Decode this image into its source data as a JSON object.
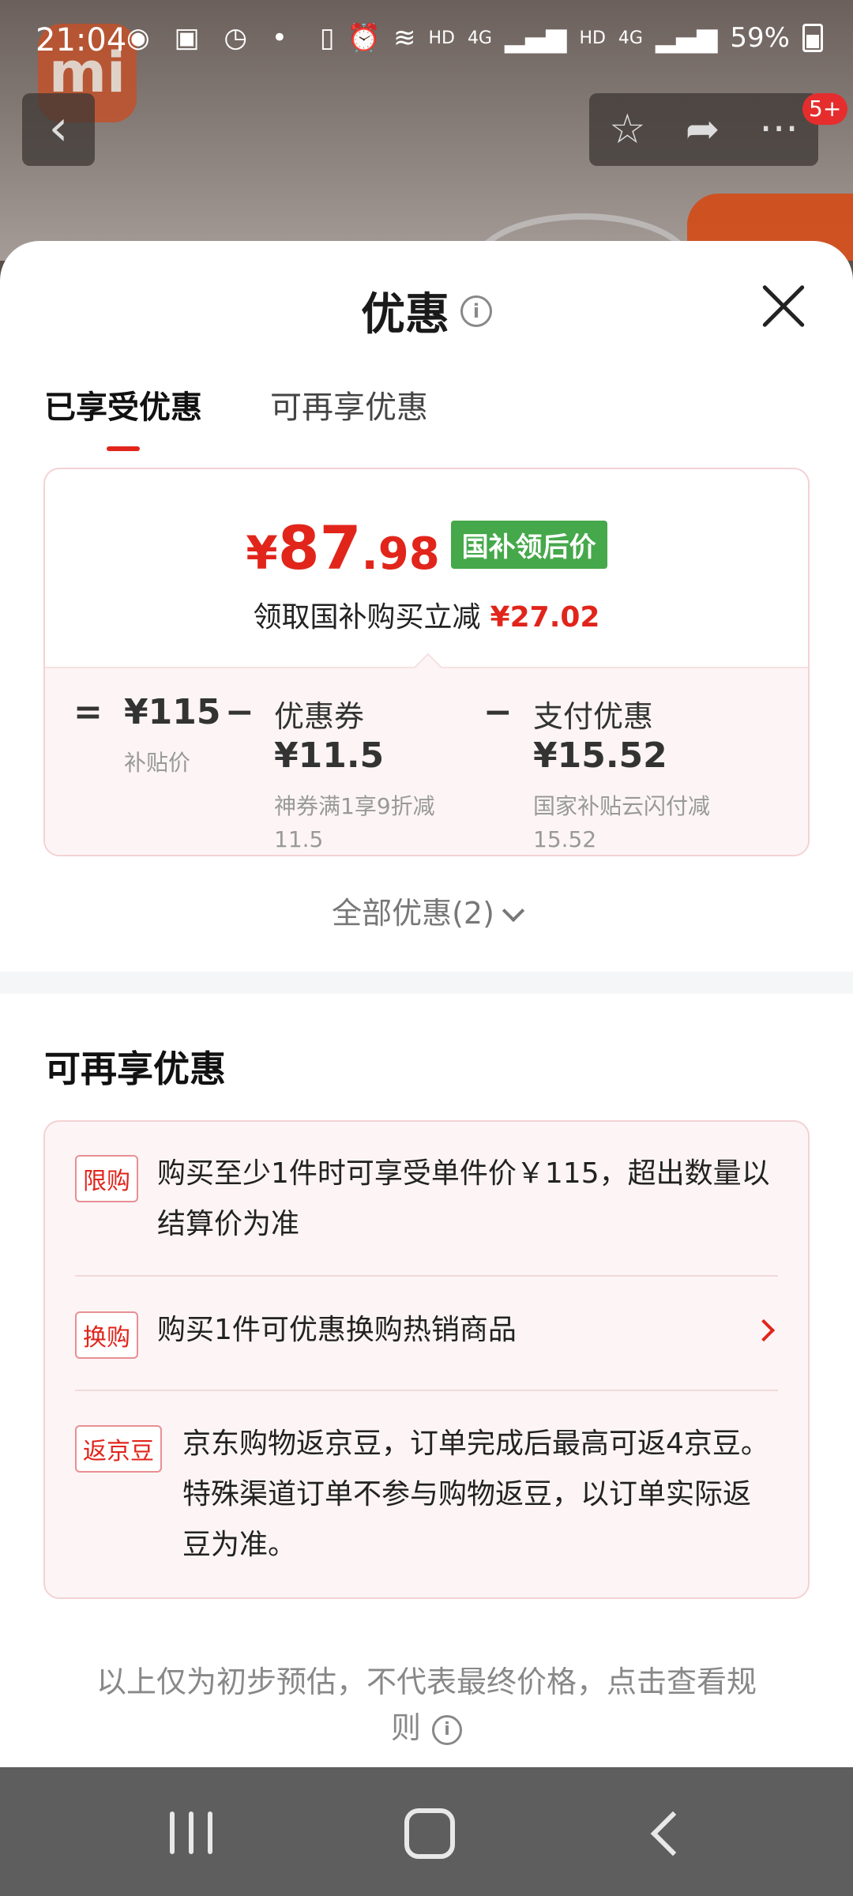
{
  "status_bar": {
    "time": "21:04",
    "network_labels": [
      "HD",
      "4G",
      "HD",
      "4G"
    ],
    "battery": "59%"
  },
  "product_page": {
    "cart_badge": "5+"
  },
  "sheet": {
    "title": "优惠",
    "tabs": [
      {
        "label": "已享受优惠",
        "active": true
      },
      {
        "label": "可再享优惠",
        "active": false
      }
    ],
    "price_card": {
      "currency": "¥",
      "price_integer": "87",
      "price_decimal": ".98",
      "price_tag": "国补领后价",
      "subtitle": "领取国补购买立减",
      "saving": "¥27.02",
      "formula": {
        "equals": "=",
        "term1": {
          "value": "¥115",
          "desc": "补贴价"
        },
        "minus1": "−",
        "term2": {
          "label": "优惠券",
          "value": "¥11.5",
          "desc": "神券满1享9折减11.5"
        },
        "minus2": "−",
        "term3": {
          "label": "支付优惠",
          "value": "¥15.52",
          "desc": "国家补贴云闪付减15.52"
        }
      }
    },
    "all_promos": "全部优惠(2)",
    "more_section": {
      "title": "可再享优惠",
      "items": [
        {
          "tag": "限购",
          "text": "购买至少1件时可享受单件价￥115，超出数量以结算价为准",
          "has_arrow": false
        },
        {
          "tag": "换购",
          "text": "购买1件可优惠换购热销商品",
          "has_arrow": true
        },
        {
          "tag": "返京豆",
          "text": "京东购物返京豆，订单完成后最高可返4京豆。特殊渠道订单不参与购物返豆，以订单实际返豆为准。",
          "has_arrow": false
        }
      ]
    },
    "footnote": "以上仅为初步预估，不代表最终价格，点击查看规则"
  },
  "colors": {
    "accent_red": "#e1251b",
    "tag_green": "#45a84a"
  }
}
